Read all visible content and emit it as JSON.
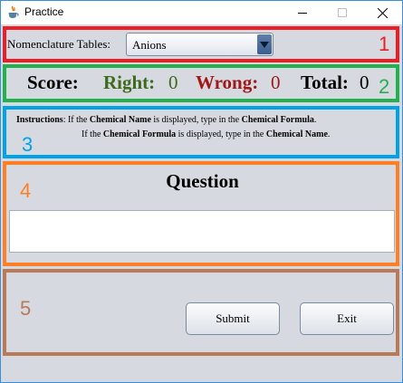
{
  "window": {
    "title": "Practice"
  },
  "section_numbers": [
    "1",
    "2",
    "3",
    "4",
    "5"
  ],
  "colors": {
    "section1": "#ee1c24",
    "section2": "#22b14c",
    "section3": "#00a2e8",
    "section4": "#ff7f27",
    "section5": "#b97a57",
    "right": "#3d6b1d",
    "wrong": "#a01818"
  },
  "nomenclature": {
    "label": "Nomenclature Tables:",
    "selected": "Anions"
  },
  "score": {
    "label": "Score:",
    "right_label": "Right:",
    "right_value": "0",
    "wrong_label": "Wrong:",
    "wrong_value": "0",
    "total_label": "Total:",
    "total_value": "0"
  },
  "instructions": {
    "label": "Instructions",
    "line1": {
      "t1": ": If the ",
      "b1": "Chemical Name",
      "t2": " is displayed, type in the ",
      "b2": "Chemical Formula",
      "t3": "."
    },
    "line2": {
      "t1": "If the ",
      "b1": "Chemical Formula",
      "t2": " is displayed, type in the ",
      "b2": "Chemical Name",
      "t3": "."
    }
  },
  "question": {
    "title": "Question",
    "answer_value": ""
  },
  "buttons": {
    "submit": "Submit",
    "exit": "Exit"
  }
}
